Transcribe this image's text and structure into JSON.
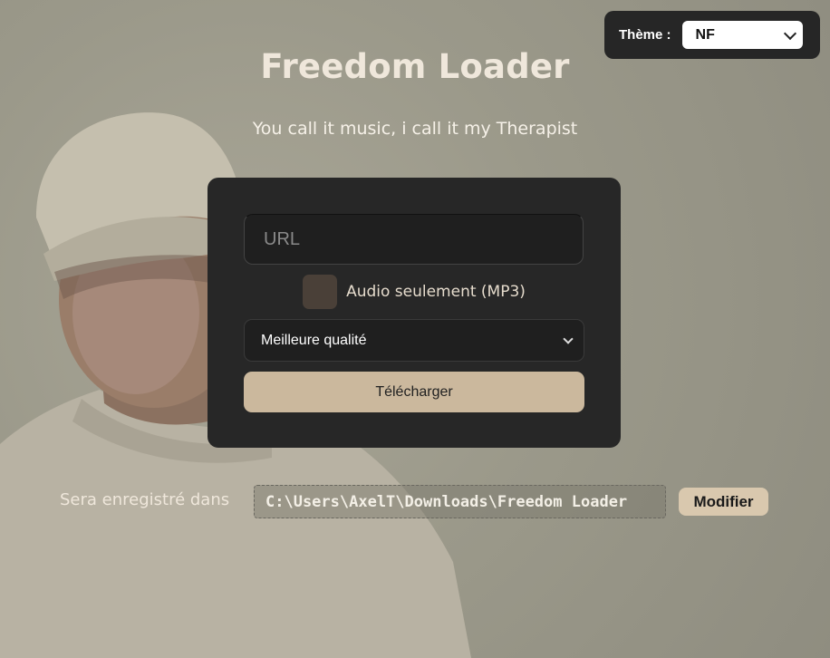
{
  "theme": {
    "label": "Thème :",
    "selected": "NF"
  },
  "header": {
    "title": "Freedom Loader",
    "subtitle": "You call it music, i call it my Therapist"
  },
  "form": {
    "url_placeholder": "URL",
    "audio_only_label": "Audio seulement (MP3)",
    "audio_only_checked": false,
    "quality_selected": "Meilleure qualité",
    "download_label": "Télécharger"
  },
  "save": {
    "label": "Sera enregistré dans",
    "path": "C:\\Users\\AxelT\\Downloads\\Freedom Loader",
    "modify_label": "Modifier"
  },
  "colors": {
    "accent": "#cbb89d",
    "card_bg": "#272727",
    "page_bg": "#9b998a"
  }
}
